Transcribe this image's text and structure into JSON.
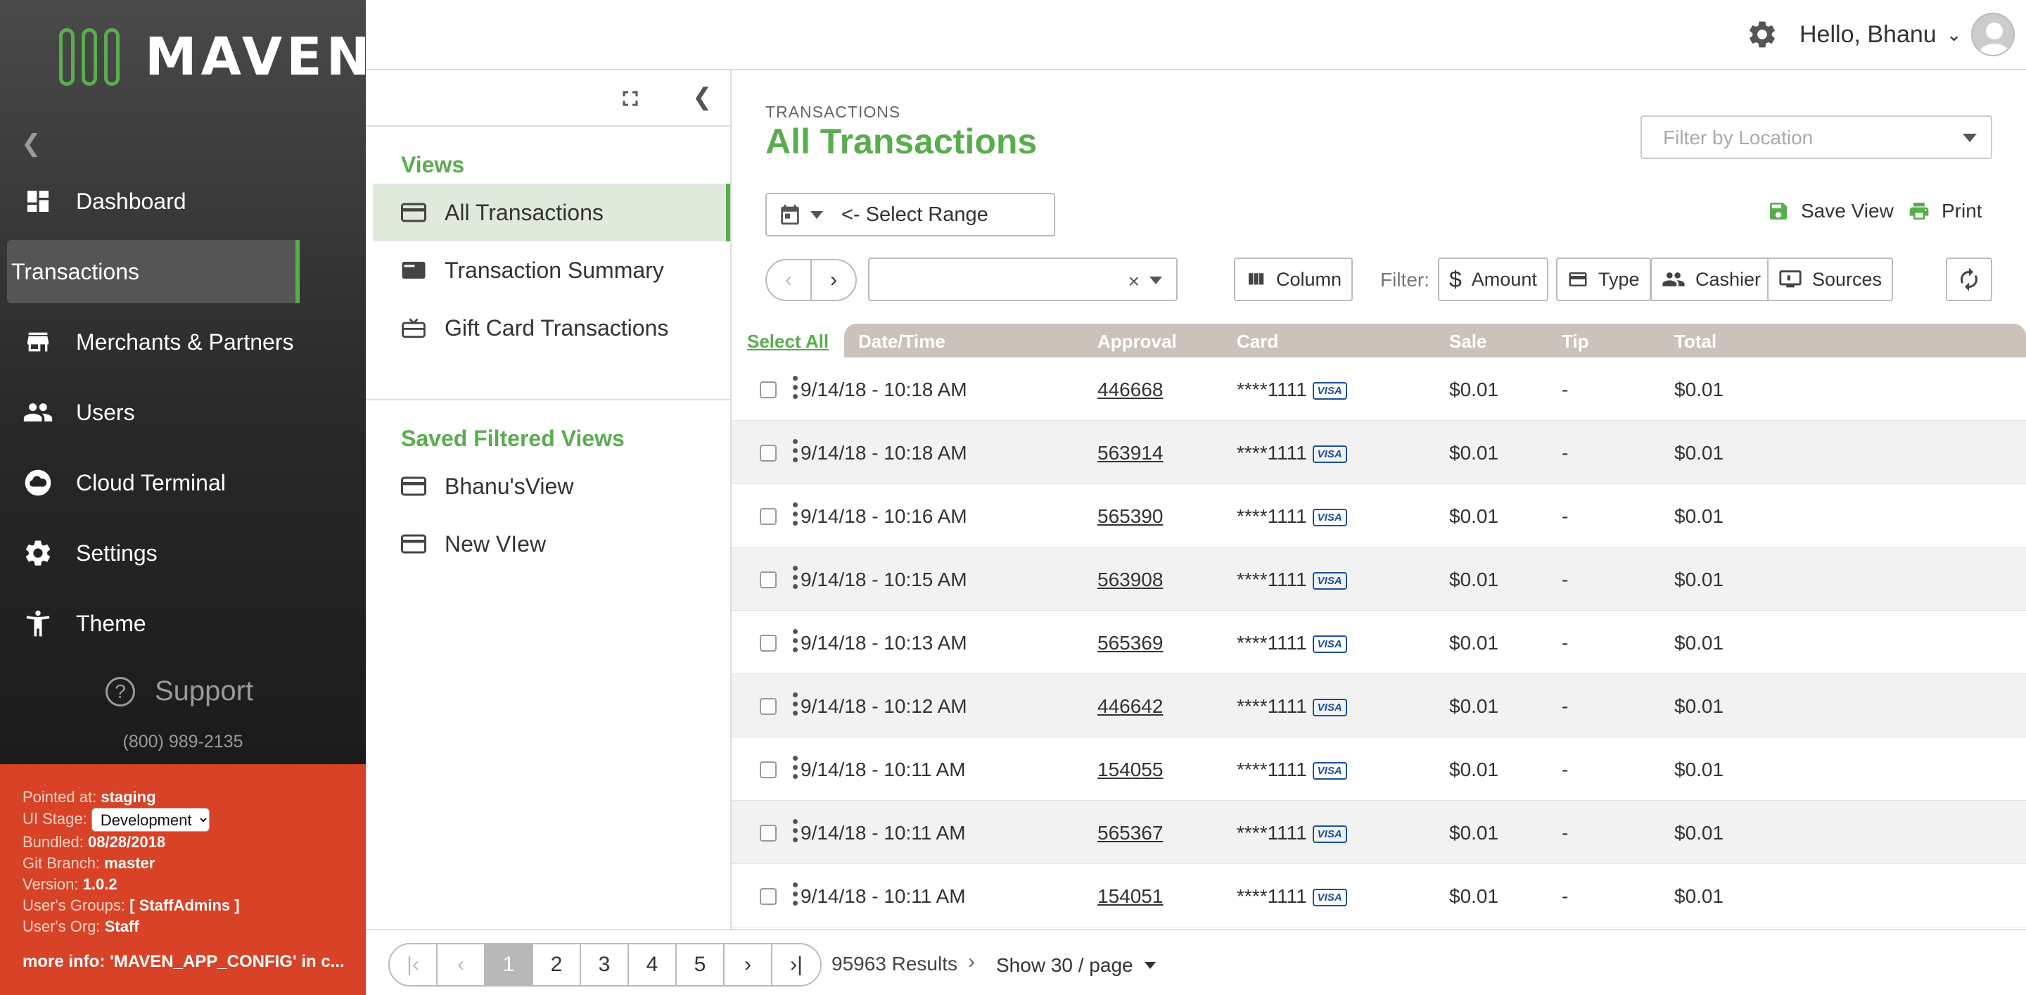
{
  "brand": {
    "name": "MAVEN",
    "accent": "#5aad4e"
  },
  "sidebar": {
    "items": [
      {
        "label": "Dashboard",
        "icon": "dashboard-icon"
      },
      {
        "label": "Transactions",
        "icon": "",
        "active": true
      },
      {
        "label": "Merchants & Partners",
        "icon": "store-icon"
      },
      {
        "label": "Users",
        "icon": "users-icon"
      },
      {
        "label": "Cloud Terminal",
        "icon": "cloud-icon"
      },
      {
        "label": "Settings",
        "icon": "gear-icon"
      },
      {
        "label": "Theme",
        "icon": "accessibility-icon"
      }
    ],
    "support_label": "Support",
    "phone": "(800) 989-2135"
  },
  "devinfo": {
    "pointed_label": "Pointed at:",
    "pointed": "staging",
    "stage_label": "UI Stage:",
    "stage": "Development",
    "bundled_label": "Bundled:",
    "bundled": "08/28/2018",
    "branch_label": "Git Branch:",
    "branch": "master",
    "version_label": "Version:",
    "version": "1.0.2",
    "groups_label": "User's Groups:",
    "groups": "[ StaffAdmins ]",
    "org_label": "User's Org:",
    "org": "Staff",
    "more": "more info: 'MAVEN_APP_CONFIG' in c..."
  },
  "topbar": {
    "greeting": "Hello, Bhanu"
  },
  "views_panel": {
    "views_title": "Views",
    "views": [
      "All Transactions",
      "Transaction Summary",
      "Gift Card Transactions"
    ],
    "saved_title": "Saved Filtered Views",
    "saved": [
      "Bhanu'sView",
      "New VIew"
    ]
  },
  "main": {
    "breadcrumb": "TRANSACTIONS",
    "title": "All Transactions",
    "location_placeholder": "Filter by Location",
    "range_label": "<- Select Range",
    "save_view": "Save View",
    "print": "Print",
    "clear": "×",
    "column_btn": "Column",
    "filter_label": "Filter:",
    "filters": [
      "Amount",
      "Type",
      "Cashier",
      "Sources"
    ]
  },
  "table": {
    "select_all": "Select All",
    "headers": [
      "Date/Time",
      "Approval",
      "Card",
      "Sale",
      "Tip",
      "Total"
    ],
    "rows": [
      {
        "datetime": "9/14/18 - 10:18 AM",
        "approval": "446668",
        "card": "****1111",
        "brand": "VISA",
        "sale": "$0.01",
        "tip": "-",
        "total": "$0.01"
      },
      {
        "datetime": "9/14/18 - 10:18 AM",
        "approval": "563914",
        "card": "****1111",
        "brand": "VISA",
        "sale": "$0.01",
        "tip": "-",
        "total": "$0.01"
      },
      {
        "datetime": "9/14/18 - 10:16 AM",
        "approval": "565390",
        "card": "****1111",
        "brand": "VISA",
        "sale": "$0.01",
        "tip": "-",
        "total": "$0.01"
      },
      {
        "datetime": "9/14/18 - 10:15 AM",
        "approval": "563908",
        "card": "****1111",
        "brand": "VISA",
        "sale": "$0.01",
        "tip": "-",
        "total": "$0.01"
      },
      {
        "datetime": "9/14/18 - 10:13 AM",
        "approval": "565369",
        "card": "****1111",
        "brand": "VISA",
        "sale": "$0.01",
        "tip": "-",
        "total": "$0.01"
      },
      {
        "datetime": "9/14/18 - 10:12 AM",
        "approval": "446642",
        "card": "****1111",
        "brand": "VISA",
        "sale": "$0.01",
        "tip": "-",
        "total": "$0.01"
      },
      {
        "datetime": "9/14/18 - 10:11 AM",
        "approval": "154055",
        "card": "****1111",
        "brand": "VISA",
        "sale": "$0.01",
        "tip": "-",
        "total": "$0.01"
      },
      {
        "datetime": "9/14/18 - 10:11 AM",
        "approval": "565367",
        "card": "****1111",
        "brand": "VISA",
        "sale": "$0.01",
        "tip": "-",
        "total": "$0.01"
      },
      {
        "datetime": "9/14/18 - 10:11 AM",
        "approval": "154051",
        "card": "****1111",
        "brand": "VISA",
        "sale": "$0.01",
        "tip": "-",
        "total": "$0.01"
      }
    ]
  },
  "pagination": {
    "pages": [
      "1",
      "2",
      "3",
      "4",
      "5"
    ],
    "current": "1",
    "results": "95963 Results",
    "per_page": "Show 30 / page"
  }
}
